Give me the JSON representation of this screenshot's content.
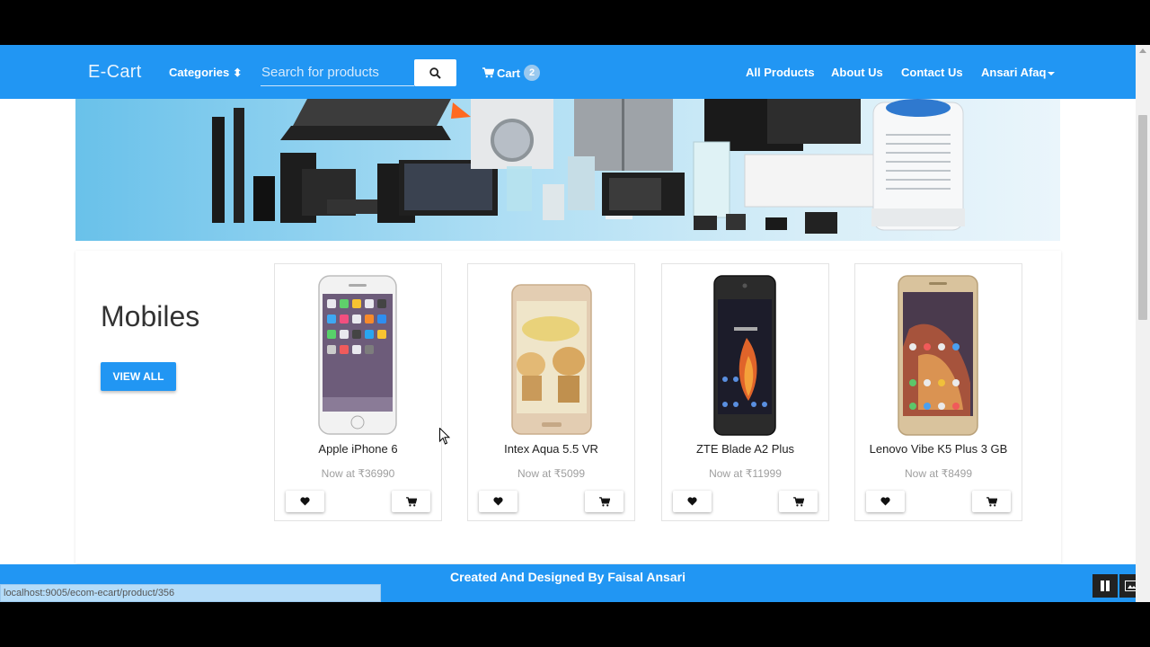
{
  "navbar": {
    "brand": "E-Cart",
    "categories_label": "Categories",
    "search_placeholder": "Search for products",
    "cart_label": "Cart",
    "cart_count": "2",
    "links": [
      "All Products",
      "About Us",
      "Contact Us"
    ],
    "user": "Ansari Afaq"
  },
  "section": {
    "title": "Mobiles",
    "view_all": "VIEW ALL"
  },
  "products": [
    {
      "name": "Apple iPhone 6",
      "price": "Now at ₹36990",
      "phone_color": "#f2f2f2"
    },
    {
      "name": "Intex Aqua 5.5 VR",
      "price": "Now at ₹5099",
      "phone_color": "#e3cdb2"
    },
    {
      "name": "ZTE Blade A2 Plus",
      "price": "Now at ₹11999",
      "phone_color": "#2b2b2b"
    },
    {
      "name": "Lenovo Vibe K5 Plus 3 GB",
      "price": "Now at ₹8499",
      "phone_color": "#d9c39d"
    }
  ],
  "footer": {
    "credit": "Created And Designed By Faisal Ansari"
  },
  "status_url": "localhost:9005/ecom-ecart/product/356",
  "colors": {
    "primary": "#2196f3"
  }
}
